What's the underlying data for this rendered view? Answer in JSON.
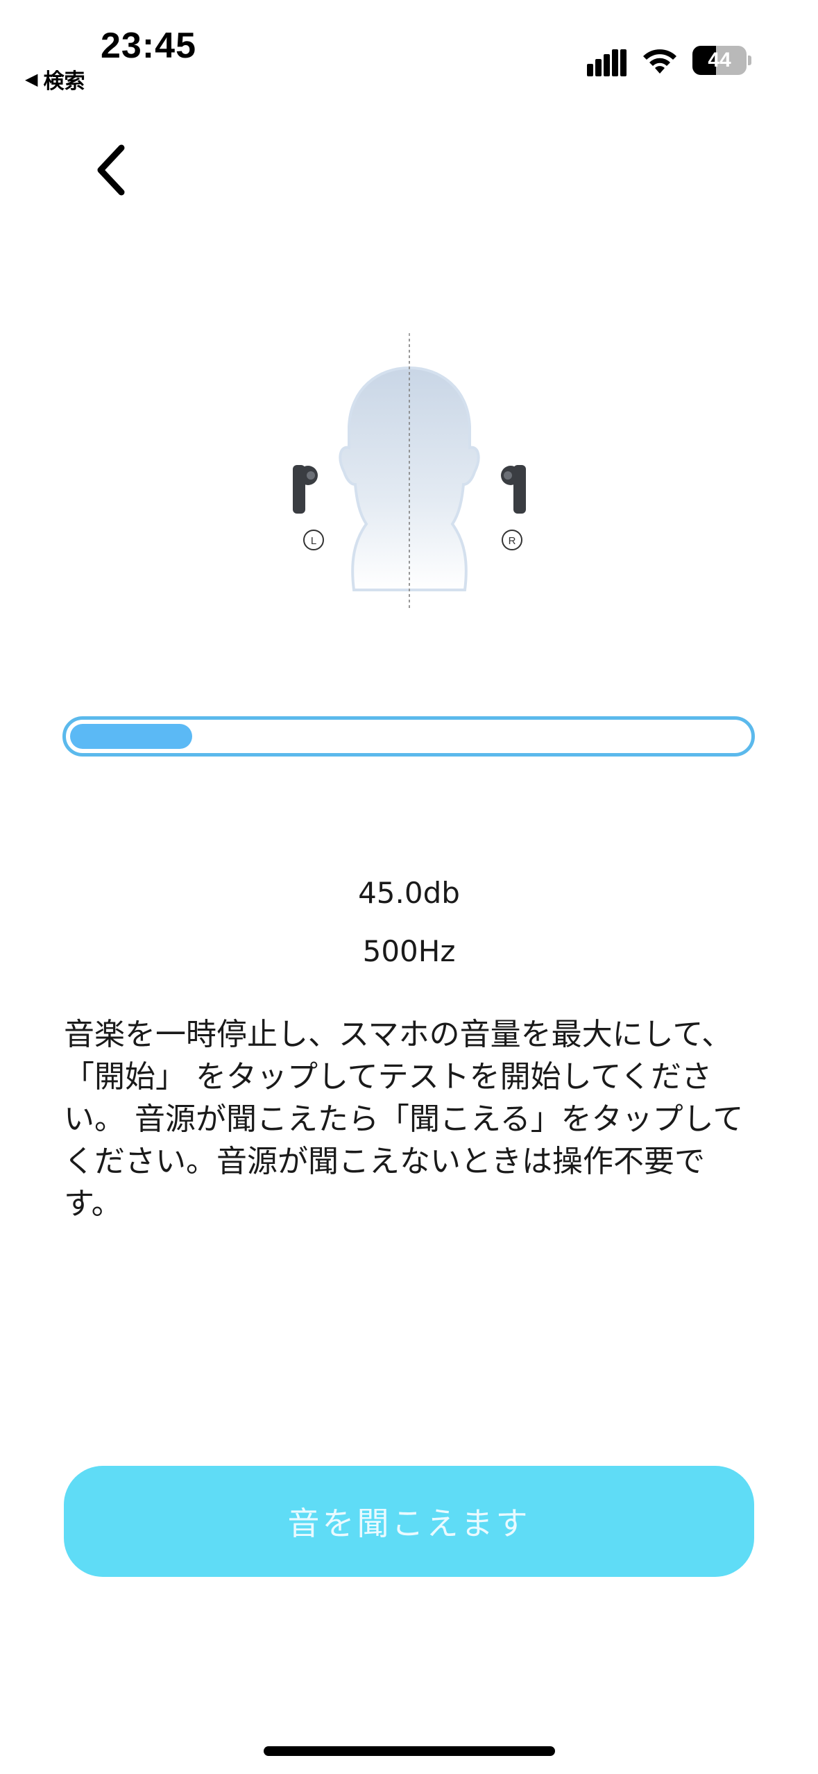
{
  "status_bar": {
    "time": "23:45",
    "back_app": "検索",
    "battery": "44",
    "battery_level": 0.44
  },
  "hearing_test": {
    "progress": 0.18,
    "level": "45.0db",
    "frequency": "500Hz",
    "instructions": "音楽を一時停止し、スマホの音量を最大にして、「開始」 をタップしてテストを開始してください。 音源が聞こえたら「聞こえる」をタップしてください。音源が聞こえないときは操作不要です。",
    "left_label": "L",
    "right_label": "R"
  },
  "actions": {
    "hear_button_label": "音を聞こえます"
  },
  "colors": {
    "accent": "#5bb9ec",
    "button": "#5fdcf6"
  },
  "icons": {
    "back": "chevron-left-icon",
    "signal": "cellular-signal-icon",
    "wifi": "wifi-icon",
    "battery": "battery-icon"
  }
}
